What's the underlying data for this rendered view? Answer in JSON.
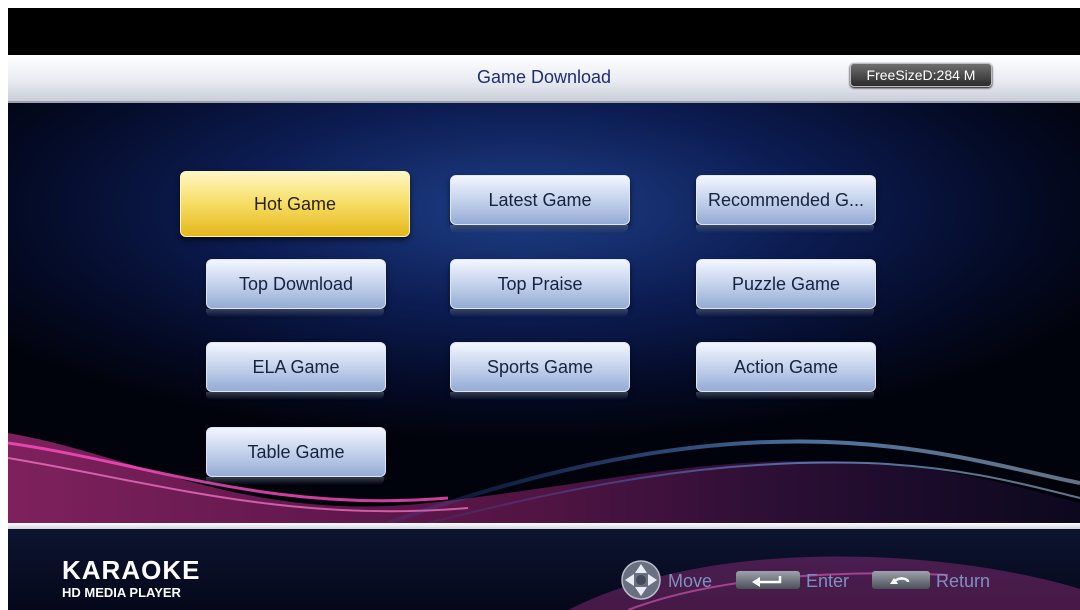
{
  "header": {
    "title": "Game Download",
    "free_size": "FreeSizeD:284 M"
  },
  "menu": {
    "selected": "Hot Game",
    "items": [
      {
        "label": "Hot Game"
      },
      {
        "label": "Latest Game"
      },
      {
        "label": "Recommended G..."
      },
      {
        "label": "Top Download"
      },
      {
        "label": "Top Praise"
      },
      {
        "label": "Puzzle Game"
      },
      {
        "label": "ELA Game"
      },
      {
        "label": "Sports Game"
      },
      {
        "label": "Action Game"
      },
      {
        "label": "Table Game"
      }
    ]
  },
  "footer": {
    "logo_main": "KARAOKE",
    "logo_sub": "HD MEDIA PLAYER",
    "hints": {
      "move": "Move",
      "enter": "Enter",
      "return": "Return"
    }
  },
  "colors": {
    "title_text": "#1e2d78",
    "selected_button": "#f6dd63",
    "button": "#c9d6ee",
    "background": "#0c1c52"
  }
}
